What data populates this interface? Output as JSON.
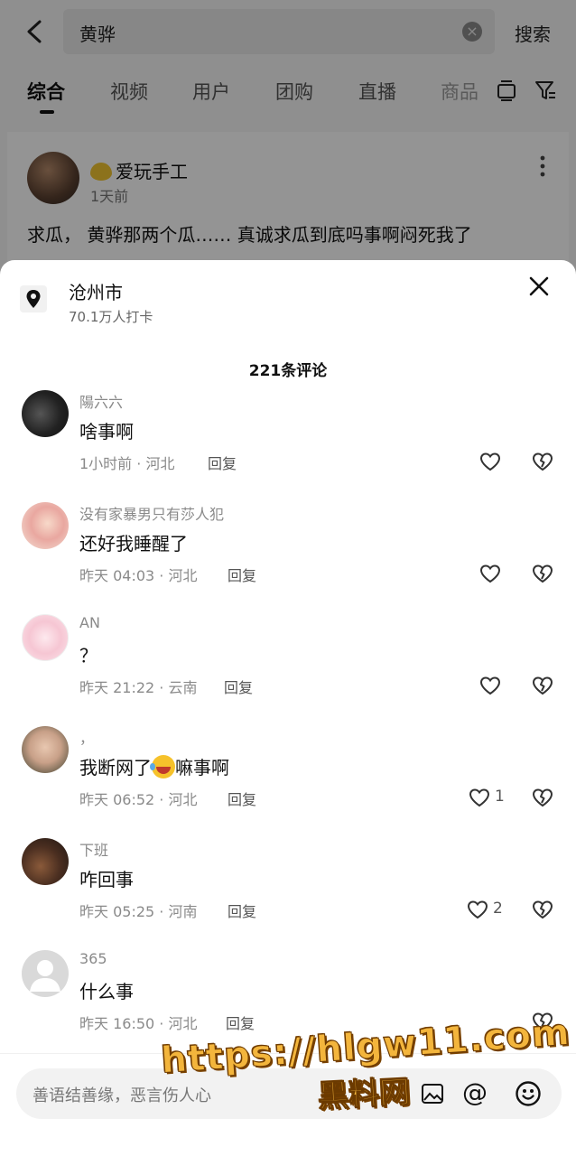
{
  "search": {
    "query": "黄骅",
    "button": "搜索"
  },
  "tabs": [
    "综合",
    "视频",
    "用户",
    "团购",
    "直播",
    "商品"
  ],
  "post": {
    "author": "爱玩手工",
    "time": "1天前",
    "text": "求瓜， 黄骅那两个瓜…… 真诚求瓜到底吗事啊闷死我了"
  },
  "location": {
    "name": "沧州市",
    "checkins": "70.1万人打卡"
  },
  "comment_count": "221条评论",
  "comments": [
    {
      "user": "陽六六",
      "text": "啥事啊",
      "meta": "1小时前 · 河北",
      "reply": "回复",
      "likes": ""
    },
    {
      "user": "没有家暴男只有莎人犯",
      "text": "还好我睡醒了",
      "meta": "昨天 04:03 · 河北",
      "reply": "回复",
      "likes": ""
    },
    {
      "user": "AN",
      "text": "？",
      "meta": "昨天 21:22 · 云南",
      "reply": "回复",
      "likes": ""
    },
    {
      "user": "，",
      "text_before": "我断网了",
      "text_after": "嘛事啊",
      "meta": "昨天 06:52 · 河北",
      "reply": "回复",
      "likes": "1"
    },
    {
      "user": "下班",
      "text": "咋回事",
      "meta": "昨天 05:25 · 河南",
      "reply": "回复",
      "likes": "2"
    },
    {
      "user": "365",
      "text": "什么事",
      "meta": "昨天 16:50 · 河北",
      "reply": "回复",
      "likes": ""
    }
  ],
  "input": {
    "placeholder": "善语结善缘，恶言伤人心"
  },
  "watermark": {
    "url": "https://hlgw11.com",
    "name": "黑料网"
  },
  "colors": {
    "watermark": "#f3b53c",
    "sheet_bg": "#ffffff"
  },
  "icons": [
    "back-arrow-icon",
    "clear-icon",
    "stack-icon",
    "filter-icon",
    "more-vertical-icon",
    "location-pin-icon",
    "close-icon",
    "heart-icon",
    "broken-heart-icon",
    "image-icon",
    "at-icon",
    "smile-icon"
  ]
}
